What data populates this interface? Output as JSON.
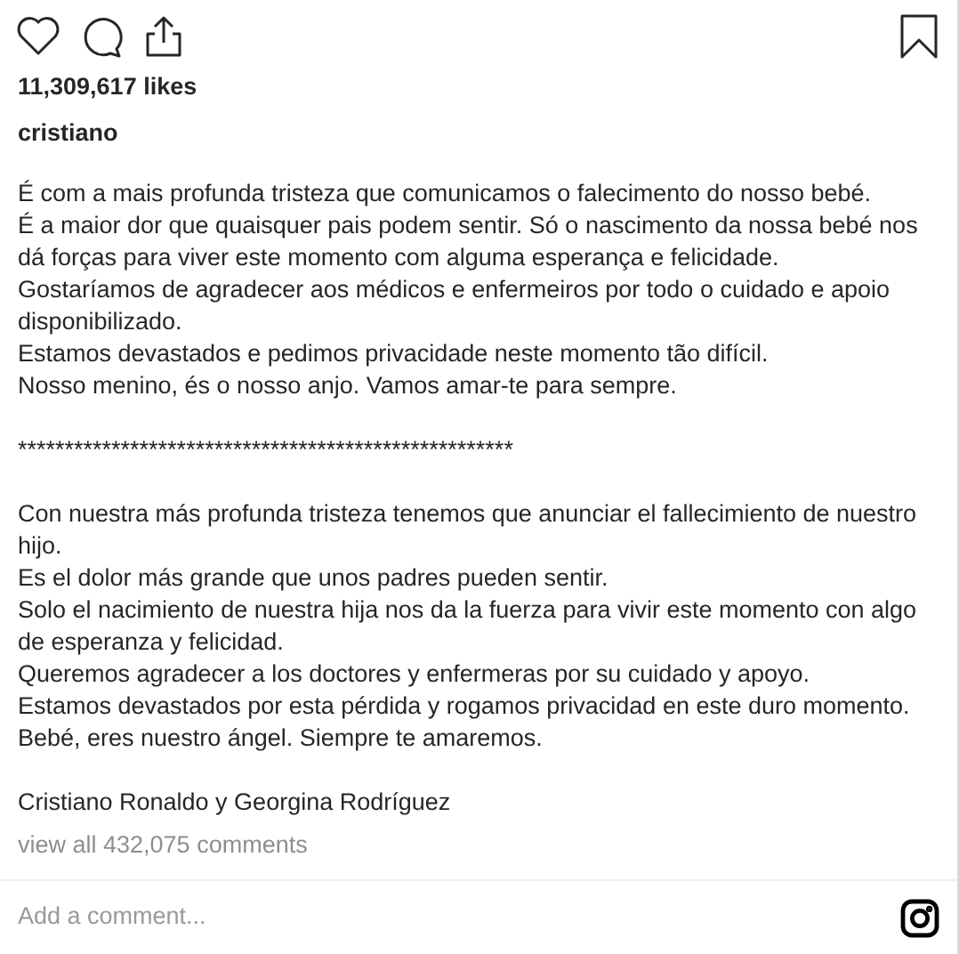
{
  "likes": "11,309,617 likes",
  "username": "cristiano",
  "caption": [
    [
      "É com a mais profunda tristeza que comunicamos o falecimento do nosso bebé.",
      "É a maior dor que quaisquer pais podem sentir. Só o nascimento da nossa bebé nos dá forças para viver este momento com alguma esperança e felicidade.",
      "Gostaríamos de agradecer aos médicos e enfermeiros por todo o cuidado e apoio disponibilizado.",
      "Estamos devastados e pedimos privacidade neste momento tão difícil.",
      "Nosso menino, és o nosso anjo. Vamos amar-te para sempre."
    ],
    [
      "*****************************************************"
    ],
    [
      "Con nuestra más profunda tristeza tenemos que anunciar el fallecimiento de nuestro hijo.",
      "Es el dolor más grande que unos padres pueden sentir.",
      "Solo el nacimiento de nuestra hija nos da la fuerza para vivir este momento con algo de esperanza y felicidad.",
      "Queremos agradecer a los doctores y enfermeras por su cuidado y apoyo.",
      "Estamos devastados por esta pérdida y rogamos privacidad en este duro momento.",
      "Bebé, eres nuestro ángel. Siempre te amaremos."
    ],
    [
      "Cristiano Ronaldo y Georgina Rodríguez"
    ]
  ],
  "view_comments": "view all 432,075 comments",
  "comment_field": {
    "placeholder": "Add a comment..."
  }
}
